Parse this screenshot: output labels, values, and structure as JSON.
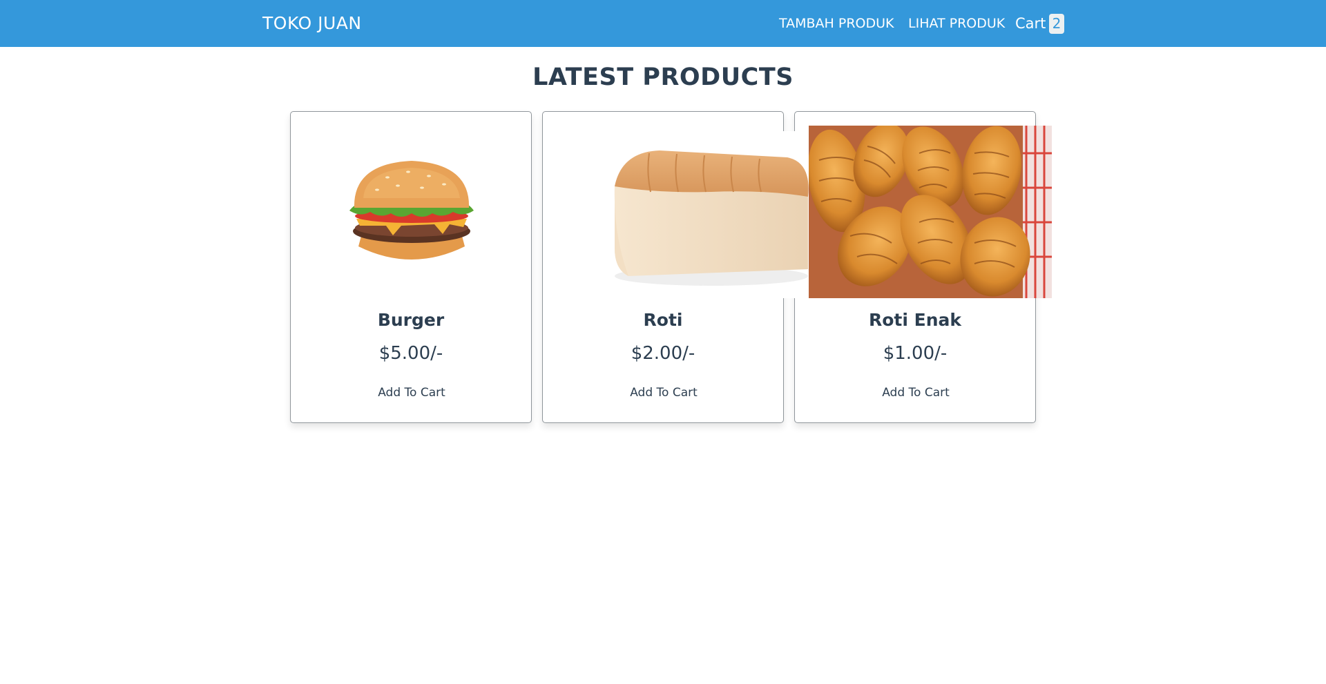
{
  "header": {
    "brand": "TOKO JUAN",
    "nav_tambah": "TAMBAH PRODUK",
    "nav_lihat": "LIHAT PRODUK",
    "cart_label": "Cart",
    "cart_count": "2",
    "background_color": "#3498db"
  },
  "main": {
    "title": "LATEST PRODUCTS"
  },
  "products": [
    {
      "name": "Burger",
      "price": "$5.00/-",
      "button": "Add To Cart",
      "image": "burger-image"
    },
    {
      "name": "Roti",
      "price": "$2.00/-",
      "button": "Add To Cart",
      "image": "bread-loaf-image"
    },
    {
      "name": "Roti Enak",
      "price": "$1.00/-",
      "button": "Add To Cart",
      "image": "sweet-rolls-image"
    }
  ]
}
